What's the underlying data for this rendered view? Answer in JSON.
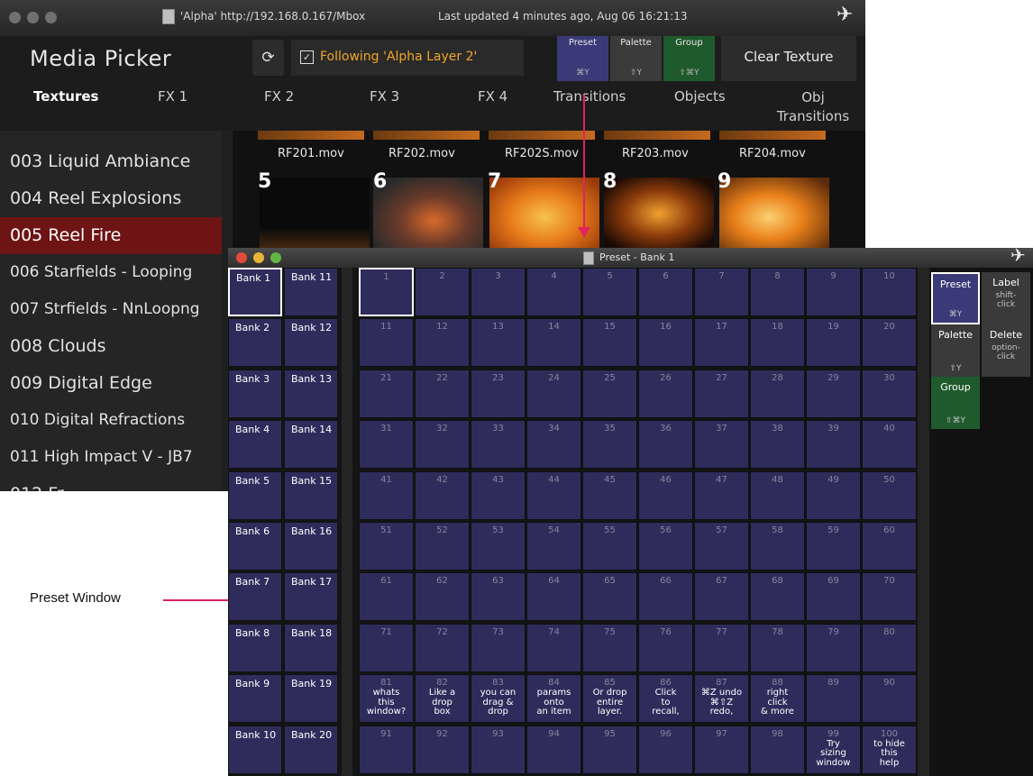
{
  "media_picker": {
    "window_title": "'Alpha' http://192.168.0.167/Mbox",
    "last_updated": "Last updated 4 minutes ago, Aug 06 16:21:13",
    "app_title": "Media Picker",
    "following_label": "Following 'Alpha Layer 2'",
    "mode_buttons": [
      {
        "label": "Preset",
        "shortcut": "⌘Y"
      },
      {
        "label": "Palette",
        "shortcut": "⇧Y"
      },
      {
        "label": "Group",
        "shortcut": "⇧⌘Y"
      }
    ],
    "clear_label": "Clear Texture",
    "tabs": [
      "Textures",
      "FX 1",
      "FX 2",
      "FX 3",
      "FX 4",
      "Transitions",
      "Objects",
      "Obj\nTransitions"
    ],
    "folders": [
      "003 Liquid Ambiance",
      "004 Reel Explosions",
      "005 Reel Fire",
      "006 Starfields - Looping",
      "007 Strfields - NnLoopng",
      "008 Clouds",
      "009 Digital Edge",
      "010 Digital Refractions",
      "011 High Impact V - JB7",
      "012 Fr..."
    ],
    "selected_folder": "005 Reel Fire",
    "files": [
      "RF201.mov",
      "RF202.mov",
      "RF202S.mov",
      "RF203.mov",
      "RF204.mov"
    ],
    "thumb_numbers": [
      "5",
      "6",
      "7",
      "8",
      "9"
    ]
  },
  "preset_window": {
    "title": "Preset - Bank 1",
    "banks": [
      "Bank 1",
      "Bank 2",
      "Bank 3",
      "Bank 4",
      "Bank 5",
      "Bank 6",
      "Bank 7",
      "Bank 8",
      "Bank 9",
      "Bank 10",
      "Bank 11",
      "Bank 12",
      "Bank 13",
      "Bank 14",
      "Bank 15",
      "Bank 16",
      "Bank 17",
      "Bank 18",
      "Bank 19",
      "Bank 20"
    ],
    "selected_bank": "Bank 1",
    "cell_labels": {
      "81": "whats\nthis\nwindow?",
      "82": "Like a\ndrop\nbox",
      "83": "you can\ndrag &\ndrop",
      "84": "params\nonto\nan item",
      "85": "Or drop\nentire\nlayer.",
      "86": "Click\nto\nrecall,",
      "87": "⌘Z undo\n⌘⇧Z\nredo,",
      "88": "right\nclick\n& more",
      "99": "Try\nsizing\nwindow",
      "100": "to hide\nthis\nhelp"
    },
    "side_buttons": [
      {
        "label": "Preset",
        "hint": "⌘Y"
      },
      {
        "label": "Label",
        "hint": "shift-\nclick"
      },
      {
        "label": "Palette",
        "hint": "⇧Y"
      },
      {
        "label": "Delete",
        "hint": "option-\nclick"
      },
      {
        "label": "Group",
        "hint": "⇧⌘Y"
      }
    ]
  },
  "caption": "Preset Window",
  "colors": {
    "cell": "#2f2c5c",
    "selected_folder": "#6e1414",
    "following_text": "#f0a42a",
    "callout_line": "#e0245e",
    "preset_button": "#3a3a78",
    "group_button": "#1f5a2c"
  }
}
